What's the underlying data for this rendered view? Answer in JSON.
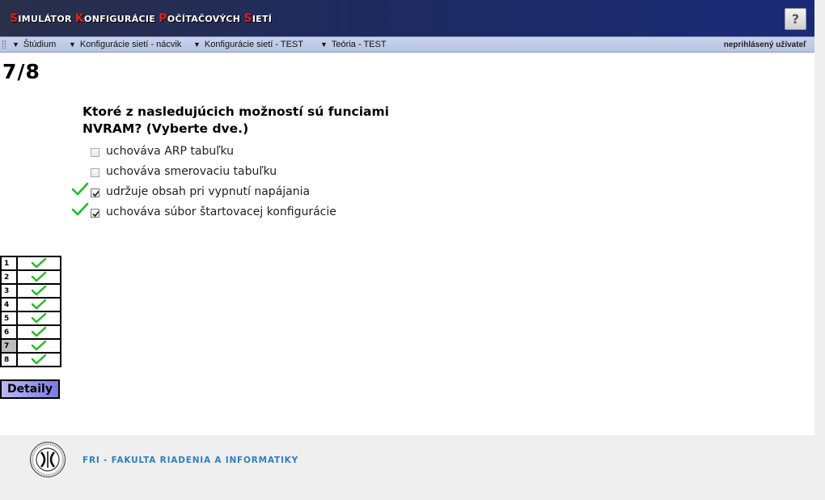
{
  "app": {
    "title_parts": [
      {
        "cap": "S",
        "rest": "IMULÁTOR "
      },
      {
        "cap": "K",
        "rest": "ONFIGURÁCIE "
      },
      {
        "cap": "P",
        "rest": "OČÍTAČOVÝCH "
      },
      {
        "cap": "S",
        "rest": "IETÍ"
      }
    ],
    "help_label": "?"
  },
  "nav": {
    "items": [
      "Štúdium",
      "Konfigurácie sietí - nácvik",
      "Konfigurácie sietí - TEST",
      "Teória - TEST"
    ],
    "user": "neprihlásený užívateľ"
  },
  "question": {
    "counter": "7/8",
    "text": "Ktoré z nasledujúcich možností sú funciami NVRAM? (Vyberte dve.)",
    "options": [
      {
        "label": "uchováva ARP tabuľku",
        "checked": false,
        "correct_mark": false
      },
      {
        "label": "uchováva smerovaciu tabuľku",
        "checked": false,
        "correct_mark": false
      },
      {
        "label": "udržuje obsah pri vypnutí napájania",
        "checked": true,
        "correct_mark": true
      },
      {
        "label": "uchováva súbor štartovacej konfigurácie",
        "checked": true,
        "correct_mark": true
      }
    ]
  },
  "question_nav": {
    "rows": [
      {
        "n": "1",
        "status": "correct"
      },
      {
        "n": "2",
        "status": "correct"
      },
      {
        "n": "3",
        "status": "correct"
      },
      {
        "n": "4",
        "status": "correct"
      },
      {
        "n": "5",
        "status": "correct"
      },
      {
        "n": "6",
        "status": "correct"
      },
      {
        "n": "7",
        "status": "correct",
        "current": true
      },
      {
        "n": "8",
        "status": "correct"
      }
    ],
    "details_label": "Detaily"
  },
  "footer": {
    "text": "FRI - FAKULTA RIADENIA A INFORMATIKY"
  },
  "colors": {
    "check_green": "#22bb22",
    "footer_blue": "#2f7fc0",
    "title_red": "#e02020"
  }
}
